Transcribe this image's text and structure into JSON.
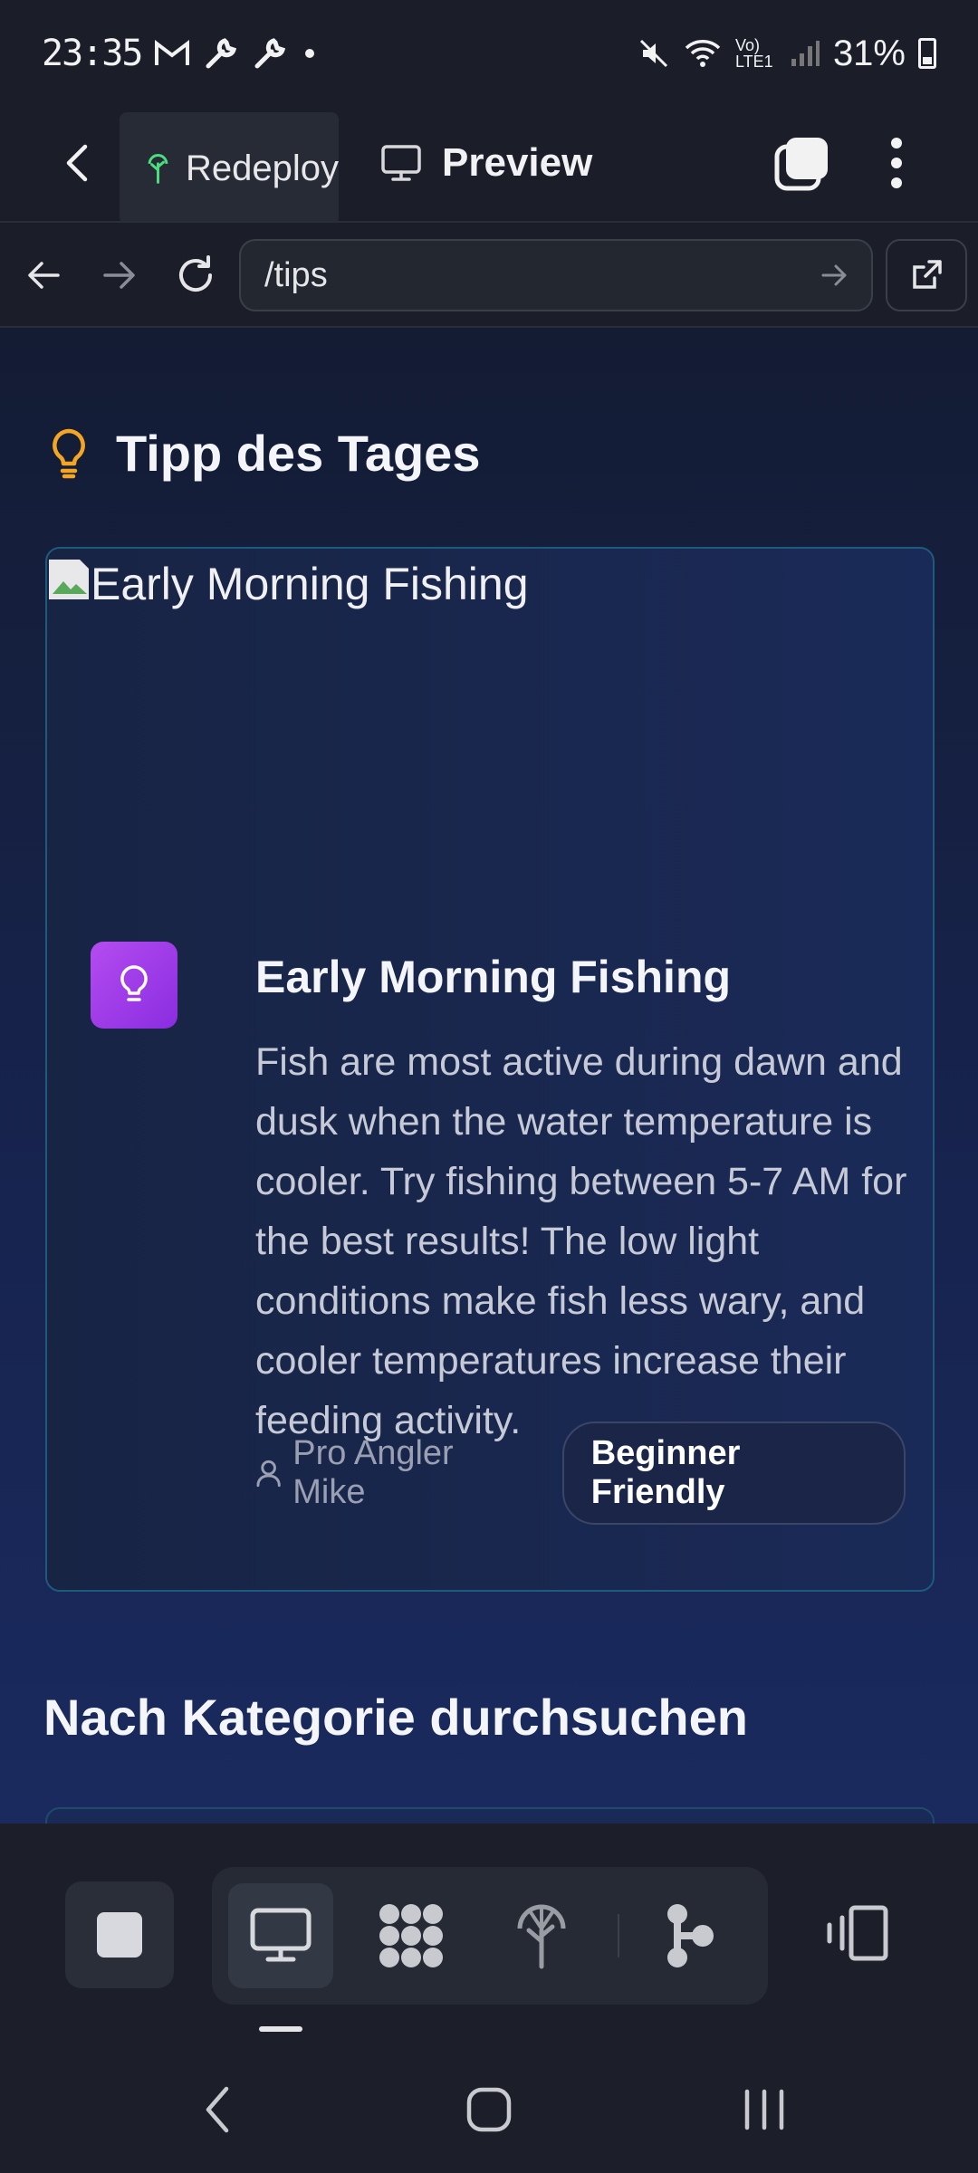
{
  "status_bar": {
    "time": "23:35",
    "battery": "31%",
    "network": "Vo) LTE1"
  },
  "header": {
    "redeploy_label": "Redeploy",
    "preview_label": "Preview"
  },
  "url_bar": {
    "path": "/tips"
  },
  "page": {
    "section_title": "Tipp des Tages",
    "tip": {
      "image_alt": "Early Morning Fishing",
      "title": "Early Morning Fishing",
      "text": "Fish are most active during dawn and dusk when the water temperature is cooler. Try fishing between 5-7 AM for the best results! The low light conditions make fish less wary, and cooler temperatures increase their feeding activity.",
      "author": "Pro Angler Mike",
      "badge": "Beginner Friendly"
    },
    "category_title": "Nach Kategorie durchsuchen"
  },
  "colors": {
    "accent_bulb": "#f5a524",
    "tip_icon": "#a43ee8",
    "redeploy_icon": "#4ade80"
  },
  "icons": {
    "back": "chevron-left-icon",
    "redeploy": "tree-icon",
    "preview": "monitor-icon",
    "tabs": "tabs-icon",
    "menu": "more-vertical-icon",
    "nav_back": "arrow-left-icon",
    "nav_forward": "arrow-right-icon",
    "reload": "reload-icon",
    "go": "arrow-right-icon",
    "external": "external-link-icon",
    "section": "lightbulb-icon",
    "tip": "lightbulb-icon",
    "author": "user-icon",
    "stop": "stop-icon",
    "desktop": "monitor-icon",
    "grid": "grid-icon",
    "deploy": "tree-icon",
    "nodes": "nodes-icon",
    "device": "device-icon"
  }
}
